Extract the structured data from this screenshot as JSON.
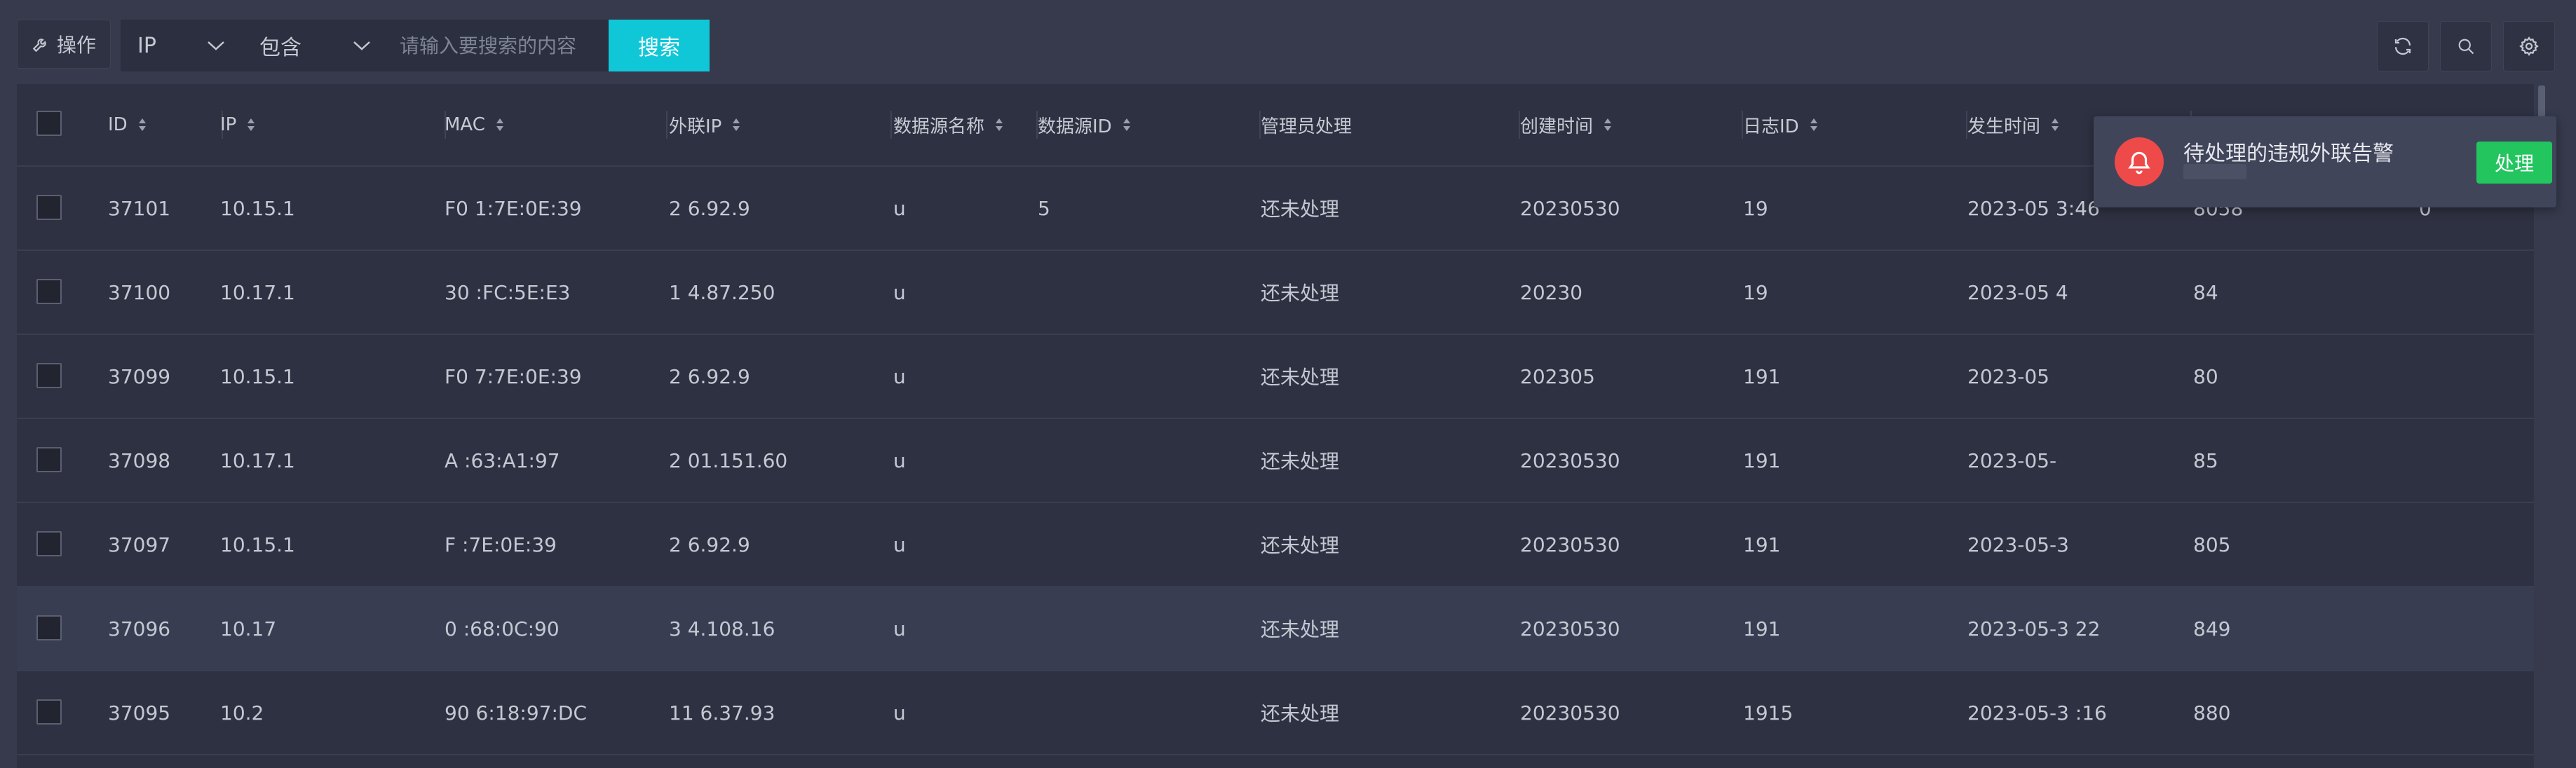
{
  "toolbar": {
    "operation_label": "操作",
    "field_select": "IP",
    "match_select": "包含",
    "search_placeholder": "请输入要搜索的内容",
    "search_label": "搜索"
  },
  "table": {
    "columns": [
      "ID",
      "IP",
      "MAC",
      "外联IP",
      "数据源名称",
      "数据源ID",
      "管理员处理",
      "创建时间",
      "日志ID",
      "发生时间"
    ],
    "rows": [
      {
        "id": "37101",
        "ip": "10.15.1",
        "mac": "F0  1:7E:0E:39",
        "ext_ip": "2  6.92.9",
        "src_name": "u",
        "src_id": "5",
        "admin": "还未处理",
        "created": "20230530",
        "log_id": "19",
        "occurred": "2023-05  3:46",
        "extra1": "8058",
        "extra2": "0"
      },
      {
        "id": "37100",
        "ip": "10.17.1",
        "mac": "30  :FC:5E:E3",
        "ext_ip": "1  4.87.250",
        "src_name": "u",
        "src_id": "",
        "admin": "还未处理",
        "created": "20230",
        "log_id": "19",
        "occurred": "2023-05  4",
        "extra1": "84",
        "extra2": ""
      },
      {
        "id": "37099",
        "ip": "10.15.1",
        "mac": "F0  7:7E:0E:39",
        "ext_ip": "2  6.92.9",
        "src_name": "u",
        "src_id": "",
        "admin": "还未处理",
        "created": "202305",
        "log_id": "191",
        "occurred": "2023-05",
        "extra1": "80",
        "extra2": ""
      },
      {
        "id": "37098",
        "ip": "10.17.1",
        "mac": "A  :63:A1:97",
        "ext_ip": "2  01.151.60",
        "src_name": "u",
        "src_id": "",
        "admin": "还未处理",
        "created": "20230530",
        "log_id": "191",
        "occurred": "2023-05-",
        "extra1": "85",
        "extra2": ""
      },
      {
        "id": "37097",
        "ip": "10.15.1",
        "mac": "F  :7E:0E:39",
        "ext_ip": "2  6.92.9",
        "src_name": "u",
        "src_id": "",
        "admin": "还未处理",
        "created": "20230530",
        "log_id": "191",
        "occurred": "2023-05-3",
        "extra1": "805",
        "extra2": ""
      },
      {
        "id": "37096",
        "ip": "10.17",
        "mac": "0  :68:0C:90",
        "ext_ip": "3  4.108.16",
        "src_name": "u",
        "src_id": "",
        "admin": "还未处理",
        "created": "20230530",
        "log_id": "191",
        "occurred": "2023-05-3  22",
        "extra1": "849",
        "extra2": ""
      },
      {
        "id": "37095",
        "ip": "10.2",
        "mac": "90  6:18:97:DC",
        "ext_ip": "11  6.37.93",
        "src_name": "u",
        "src_id": "",
        "admin": "还未处理",
        "created": "20230530",
        "log_id": "1915",
        "occurred": "2023-05-3  :16",
        "extra1": "880",
        "extra2": ""
      }
    ]
  },
  "notification": {
    "title": "待处理的违规外联告警",
    "action_label": "处理"
  },
  "colors": {
    "accent": "#10c7d8",
    "bell": "#ef4a4a",
    "confirm": "#22c55e"
  }
}
